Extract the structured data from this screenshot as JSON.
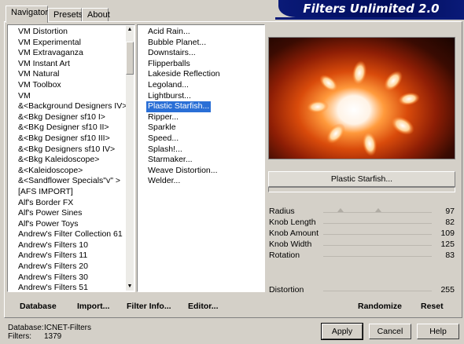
{
  "tabs": [
    {
      "label": "Navigator"
    },
    {
      "label": "Presets"
    },
    {
      "label": "About"
    }
  ],
  "banner": {
    "title": "Filters Unlimited 2.0"
  },
  "categories": [
    "VM Distortion",
    "VM Experimental",
    "VM Extravaganza",
    "VM Instant Art",
    "VM Natural",
    "VM Toolbox",
    "VM",
    "&<Background Designers IV>",
    "&<Bkg Designer sf10 I>",
    "&<BKg Designer sf10 II>",
    "&<Bkg Designer sf10 III>",
    "&<Bkg Designers sf10 IV>",
    "&<Bkg Kaleidoscope>",
    "&<Kaleidoscope>",
    "&<Sandflower Specials\"v\" >",
    "[AFS IMPORT]",
    "Alf's Border FX",
    "Alf's Power Sines",
    "Alf's Power Toys",
    "Andrew's Filter Collection 61",
    "Andrew's Filters 10",
    "Andrew's Filters 11",
    "Andrew's Filters 20",
    "Andrew's Filters 30",
    "Andrew's Filters 51"
  ],
  "filters": [
    {
      "label": "Acid Rain..."
    },
    {
      "label": "Bubble Planet..."
    },
    {
      "label": "Downstairs..."
    },
    {
      "label": "Flipperballs"
    },
    {
      "label": "Lakeside Reflection"
    },
    {
      "label": "Legoland..."
    },
    {
      "label": "Lightburst..."
    },
    {
      "label": "Plastic Starfish...",
      "selected": true
    },
    {
      "label": "Ripper..."
    },
    {
      "label": "Sparkle"
    },
    {
      "label": "Speed..."
    },
    {
      "label": "Splash!..."
    },
    {
      "label": "Starmaker..."
    },
    {
      "label": "Weave Distortion..."
    },
    {
      "label": "Welder..."
    }
  ],
  "selected_filter": "Plastic Starfish...",
  "params": [
    {
      "label": "Radius",
      "value": "97"
    },
    {
      "label": "Knob Length",
      "value": "82"
    },
    {
      "label": "Knob Amount",
      "value": "109"
    },
    {
      "label": "Knob Width",
      "value": "125"
    },
    {
      "label": "Rotation",
      "value": "83"
    }
  ],
  "distortion": {
    "label": "Distortion",
    "value": "255"
  },
  "toolbar": {
    "database": "Database",
    "import": "Import...",
    "filter_info": "Filter Info...",
    "editor": "Editor...",
    "randomize": "Randomize",
    "reset": "Reset"
  },
  "status": {
    "database_label": "Database:",
    "database_value": "ICNET-Filters",
    "filters_label": "Filters:",
    "filters_value": "1379"
  },
  "buttons": {
    "apply": "Apply",
    "cancel": "Cancel",
    "help": "Help"
  },
  "colors": {
    "selection": "#2a6fd6",
    "banner": "#0a1a78",
    "dialog_bg": "#d4d0c8"
  }
}
